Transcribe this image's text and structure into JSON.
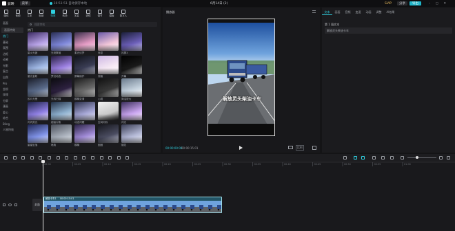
{
  "titlebar": {
    "app_name": "剪映",
    "menu_label": "菜单",
    "autosave_status": "16:51:51 自动保存本地",
    "project_title": "6月14日 (2)",
    "svip_label": "SVIP",
    "share_label": "分享",
    "export_label": "导出"
  },
  "toolbar": {
    "tools": [
      {
        "label": "媒体",
        "icon": "media-icon"
      },
      {
        "label": "音频",
        "icon": "audio-icon"
      },
      {
        "label": "文本",
        "icon": "text-icon"
      },
      {
        "label": "贴纸",
        "icon": "sticker-icon"
      },
      {
        "label": "特效",
        "icon": "effects-icon",
        "active": true
      },
      {
        "label": "转场",
        "icon": "transition-icon"
      },
      {
        "label": "字幕",
        "icon": "subtitle-icon"
      },
      {
        "label": "滤镜",
        "icon": "filter-icon"
      },
      {
        "label": "调节",
        "icon": "adjust-icon"
      },
      {
        "label": "模板",
        "icon": "template-icon"
      },
      {
        "label": "数字人",
        "icon": "avatar-icon"
      }
    ]
  },
  "effects_panel": {
    "categories": [
      "画面",
      "画面特效",
      "热门",
      "基础",
      "氛围",
      "边框",
      "动感",
      "光影",
      "复古",
      "自然",
      "Pro",
      "金粉",
      "纹理",
      "分屏",
      "漫画",
      "爱心",
      "综合",
      "Bling",
      "人物特效"
    ],
    "selected_category": "热门",
    "search_placeholder": "搜索特效",
    "section_title": "热门",
    "items": [
      "星火光团",
      "光斑飘落",
      "柔光幻梦",
      "渐显",
      "闪屏3",
      "星光金粉",
      "梦幻动态",
      "屏幕保护",
      "渐隐",
      "开幕",
      "胶片光晕",
      "光线扫描",
      "模糊变清",
      "心跳",
      "简洁放大",
      "闪闪荧光",
      "超级对焦",
      "动态闪耀",
      "空间闪烁",
      "闪光",
      "星星坠落",
      "暗角",
      "模糊",
      "圈圈",
      "烟花"
    ]
  },
  "player": {
    "title": "播放器",
    "video_caption": "解放灵头柴油卡车",
    "current_time": "00:00:00:00",
    "total_time": "00:00:15:01",
    "ratio_label": "比例",
    "colors": {
      "time": "#2fd0e0"
    }
  },
  "properties_panel": {
    "tabs": [
      "文本",
      "画面",
      "音频",
      "变速",
      "动画",
      "调整",
      "AI效果"
    ],
    "active_tab": "文本",
    "section_label": "第 1 段文本",
    "text_value": "解放灵头柴油卡车"
  },
  "timeline": {
    "ruler_labels": [
      "00:00",
      "00:05",
      "00:10",
      "00:15",
      "00:20",
      "00:25",
      "00:30",
      "00:35",
      "00:40",
      "00:45",
      "00:50",
      "00:55",
      "01:00"
    ],
    "track_label": "封面",
    "clip_name": "解放卡车1",
    "clip_duration": "00:00:15:01",
    "accent_color": "#2fd0e0"
  }
}
